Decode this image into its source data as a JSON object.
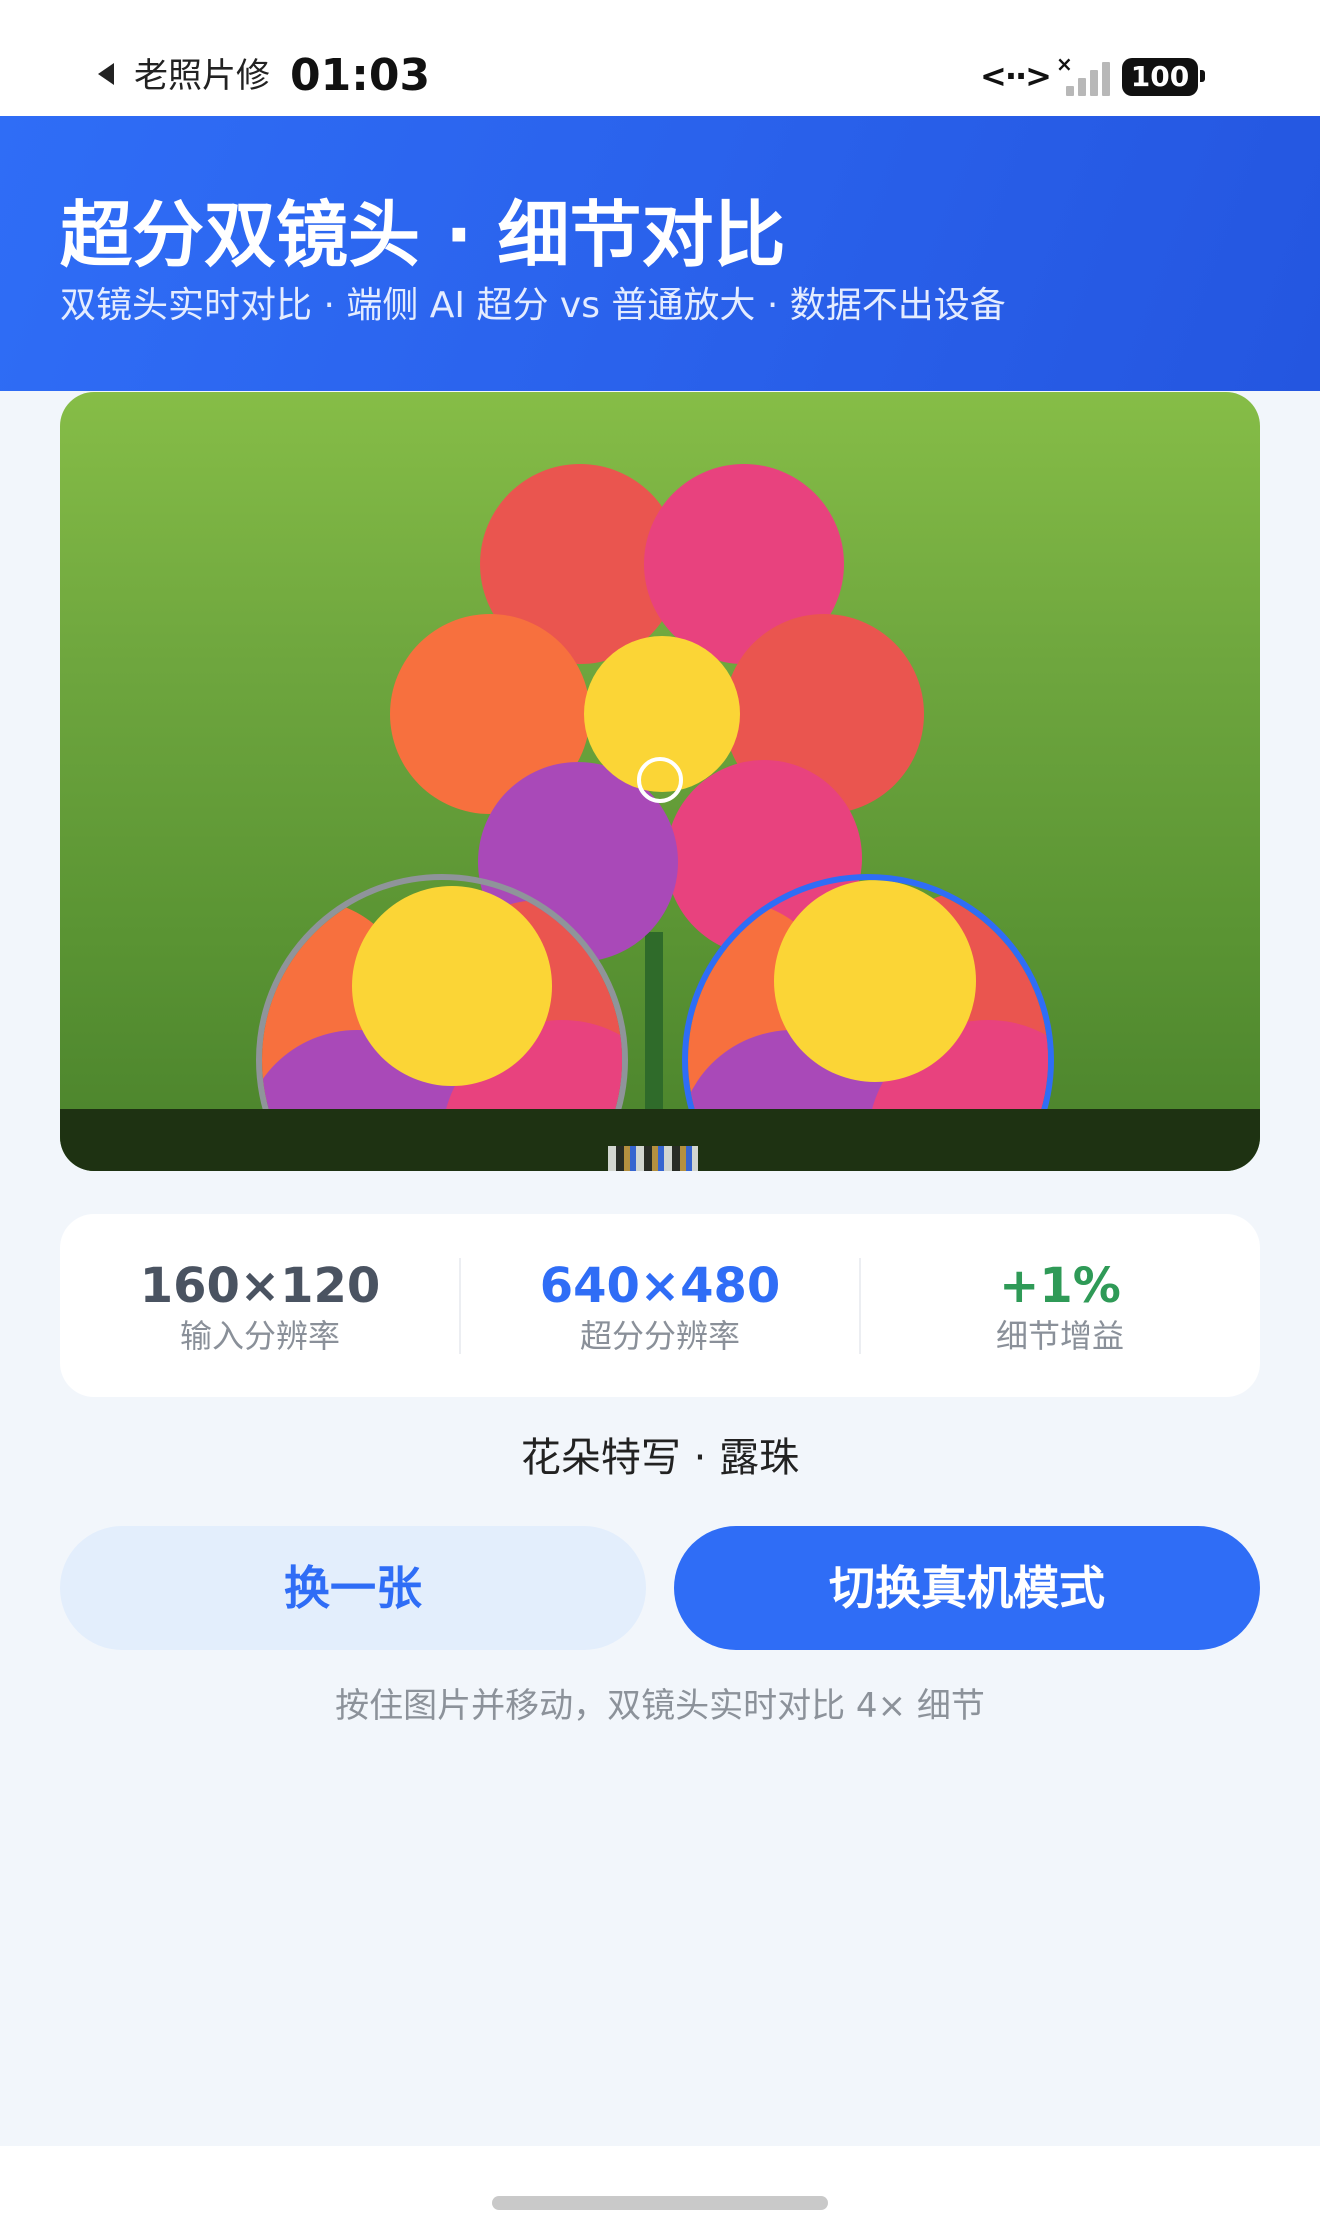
{
  "status_bar": {
    "back_app": "老照片修",
    "time": "01:03",
    "network_label": "<··>",
    "battery": "100"
  },
  "header": {
    "title": "超分双镜头 · 细节对比",
    "subtitle": "双镜头实时对比 · 端侧 AI 超分 vs 普通放大 · 数据不出设备"
  },
  "stats": [
    {
      "value": "160×120",
      "label": "输入分辨率",
      "color": "#4a5361"
    },
    {
      "value": "640×480",
      "label": "超分分辨率",
      "color": "#2f6df6"
    },
    {
      "value": "+1%",
      "label": "细节增益",
      "color": "#2f9a57"
    }
  ],
  "caption": "花朵特写 · 露珠",
  "buttons": {
    "shuffle": "换一张",
    "switch_mode": "切换真机模式"
  },
  "hint": "按住图片并移动，双镜头实时对比 4× 细节",
  "colors": {
    "accent": "#2f6df6",
    "petal_red": "#ea554f",
    "petal_pink": "#e8427e",
    "petal_orange": "#f7703e",
    "petal_purple": "#a949b8",
    "center_yellow": "#fbd536"
  }
}
